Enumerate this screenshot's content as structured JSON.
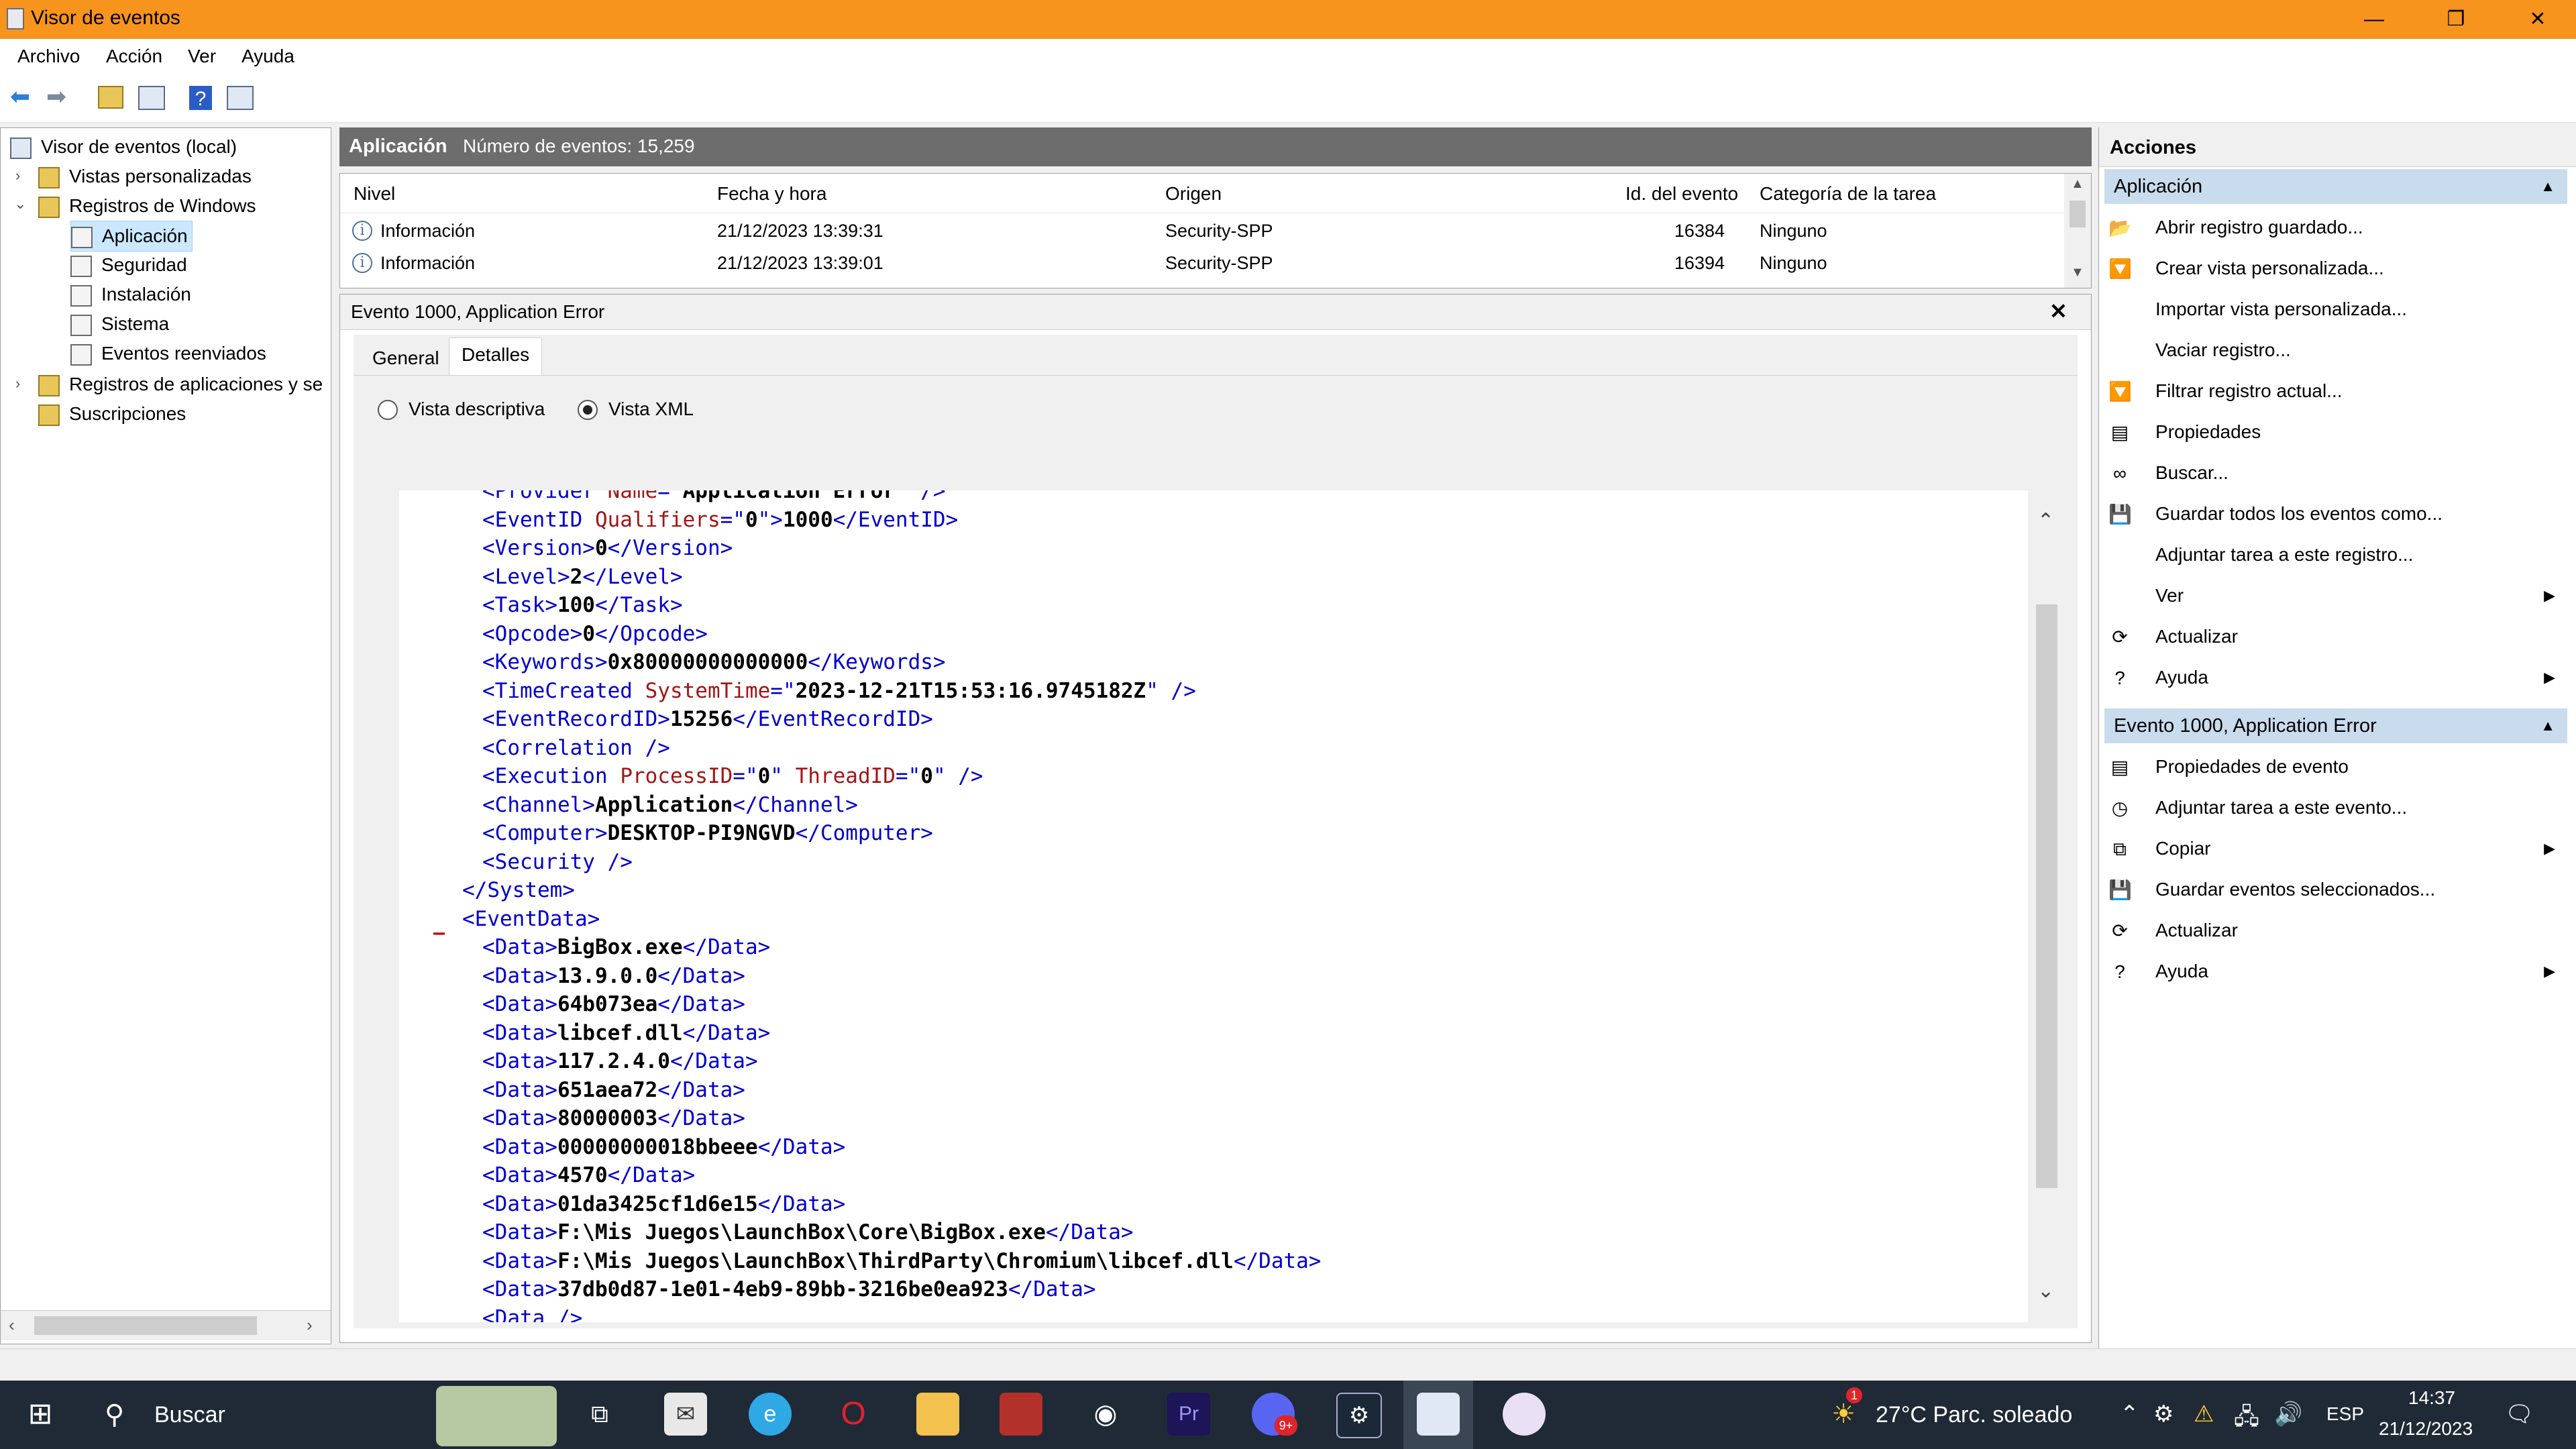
{
  "window": {
    "title": "Visor de eventos",
    "minimize_glyph": "—",
    "maximize_glyph": "❐",
    "close_glyph": "✕"
  },
  "menu": [
    "Archivo",
    "Acción",
    "Ver",
    "Ayuda"
  ],
  "toolbar_icons": [
    "back-arrow-icon",
    "forward-arrow-icon",
    "folder-up-icon",
    "show-hide-console-tree-icon",
    "help-icon",
    "show-hide-action-pane-icon"
  ],
  "tree": {
    "root": "Visor de eventos (local)",
    "custom_views": "Vistas personalizadas",
    "windows_logs": "Registros de Windows",
    "logs": [
      "Aplicación",
      "Seguridad",
      "Instalación",
      "Sistema",
      "Eventos reenviados"
    ],
    "app_logs": "Registros de aplicaciones y se",
    "subscriptions": "Suscripciones",
    "selected_log": "Aplicación"
  },
  "center": {
    "log_name": "Aplicación",
    "event_count": "Número de eventos: 15,259"
  },
  "events_table": {
    "columns": [
      "Nivel",
      "Fecha y hora",
      "Origen",
      "Id. del evento",
      "Categoría de la tarea"
    ],
    "rows": [
      {
        "level": "Información",
        "datetime": "21/12/2023 13:39:31",
        "source": "Security-SPP",
        "id": "16384",
        "category": "Ninguno"
      },
      {
        "level": "Información",
        "datetime": "21/12/2023 13:39:01",
        "source": "Security-SPP",
        "id": "16394",
        "category": "Ninguno"
      }
    ]
  },
  "detail": {
    "title": "Evento 1000, Application Error",
    "close_glyph": "✕",
    "tabs": [
      "General",
      "Detalles"
    ],
    "active_tab": "Detalles",
    "view_options": [
      "Vista descriptiva",
      "Vista XML"
    ],
    "selected_view": "Vista XML",
    "xml_collapse_marker": "–",
    "xml_lines": [
      [
        [
          "tag",
          "<Provider "
        ],
        [
          "attr",
          "Name"
        ],
        [
          "tag",
          "=\""
        ],
        [
          "val",
          "Application Error"
        ],
        [
          "tag",
          "\" />"
        ]
      ],
      [
        [
          "tag",
          "<EventID "
        ],
        [
          "attr",
          "Qualifiers"
        ],
        [
          "tag",
          "=\""
        ],
        [
          "val",
          "0"
        ],
        [
          "tag",
          "\">"
        ],
        [
          "val",
          "1000"
        ],
        [
          "tag",
          "</EventID>"
        ]
      ],
      [
        [
          "tag",
          "<Version>"
        ],
        [
          "val",
          "0"
        ],
        [
          "tag",
          "</Version>"
        ]
      ],
      [
        [
          "tag",
          "<Level>"
        ],
        [
          "val",
          "2"
        ],
        [
          "tag",
          "</Level>"
        ]
      ],
      [
        [
          "tag",
          "<Task>"
        ],
        [
          "val",
          "100"
        ],
        [
          "tag",
          "</Task>"
        ]
      ],
      [
        [
          "tag",
          "<Opcode>"
        ],
        [
          "val",
          "0"
        ],
        [
          "tag",
          "</Opcode>"
        ]
      ],
      [
        [
          "tag",
          "<Keywords>"
        ],
        [
          "val",
          "0x80000000000000"
        ],
        [
          "tag",
          "</Keywords>"
        ]
      ],
      [
        [
          "tag",
          "<TimeCreated "
        ],
        [
          "attr",
          "SystemTime"
        ],
        [
          "tag",
          "=\""
        ],
        [
          "val",
          "2023-12-21T15:53:16.9745182Z"
        ],
        [
          "tag",
          "\" />"
        ]
      ],
      [
        [
          "tag",
          "<EventRecordID>"
        ],
        [
          "val",
          "15256"
        ],
        [
          "tag",
          "</EventRecordID>"
        ]
      ],
      [
        [
          "tag",
          "<Correlation />"
        ]
      ],
      [
        [
          "tag",
          "<Execution "
        ],
        [
          "attr",
          "ProcessID"
        ],
        [
          "tag",
          "=\""
        ],
        [
          "val",
          "0"
        ],
        [
          "tag",
          "\" "
        ],
        [
          "attr",
          "ThreadID"
        ],
        [
          "tag",
          "=\""
        ],
        [
          "val",
          "0"
        ],
        [
          "tag",
          "\" />"
        ]
      ],
      [
        [
          "tag",
          "<Channel>"
        ],
        [
          "val",
          "Application"
        ],
        [
          "tag",
          "</Channel>"
        ]
      ],
      [
        [
          "tag",
          "<Computer>"
        ],
        [
          "val",
          "DESKTOP-PI9NGVD"
        ],
        [
          "tag",
          "</Computer>"
        ]
      ],
      [
        [
          "tag",
          "<Security />"
        ]
      ],
      [
        [
          "tag",
          "</System>"
        ]
      ],
      [
        [
          "tag",
          "<EventData>"
        ]
      ],
      [
        [
          "tag",
          "<Data>"
        ],
        [
          "val",
          "BigBox.exe"
        ],
        [
          "tag",
          "</Data>"
        ]
      ],
      [
        [
          "tag",
          "<Data>"
        ],
        [
          "val",
          "13.9.0.0"
        ],
        [
          "tag",
          "</Data>"
        ]
      ],
      [
        [
          "tag",
          "<Data>"
        ],
        [
          "val",
          "64b073ea"
        ],
        [
          "tag",
          "</Data>"
        ]
      ],
      [
        [
          "tag",
          "<Data>"
        ],
        [
          "val",
          "libcef.dll"
        ],
        [
          "tag",
          "</Data>"
        ]
      ],
      [
        [
          "tag",
          "<Data>"
        ],
        [
          "val",
          "117.2.4.0"
        ],
        [
          "tag",
          "</Data>"
        ]
      ],
      [
        [
          "tag",
          "<Data>"
        ],
        [
          "val",
          "651aea72"
        ],
        [
          "tag",
          "</Data>"
        ]
      ],
      [
        [
          "tag",
          "<Data>"
        ],
        [
          "val",
          "80000003"
        ],
        [
          "tag",
          "</Data>"
        ]
      ],
      [
        [
          "tag",
          "<Data>"
        ],
        [
          "val",
          "00000000018bbeee"
        ],
        [
          "tag",
          "</Data>"
        ]
      ],
      [
        [
          "tag",
          "<Data>"
        ],
        [
          "val",
          "4570"
        ],
        [
          "tag",
          "</Data>"
        ]
      ],
      [
        [
          "tag",
          "<Data>"
        ],
        [
          "val",
          "01da3425cf1d6e15"
        ],
        [
          "tag",
          "</Data>"
        ]
      ],
      [
        [
          "tag",
          "<Data>"
        ],
        [
          "val",
          "F:\\Mis Juegos\\LaunchBox\\Core\\BigBox.exe"
        ],
        [
          "tag",
          "</Data>"
        ]
      ],
      [
        [
          "tag",
          "<Data>"
        ],
        [
          "val",
          "F:\\Mis Juegos\\LaunchBox\\ThirdParty\\Chromium\\libcef.dll"
        ],
        [
          "tag",
          "</Data>"
        ]
      ],
      [
        [
          "tag",
          "<Data>"
        ],
        [
          "val",
          "37db0d87-1e01-4eb9-89bb-3216be0ea923"
        ],
        [
          "tag",
          "</Data>"
        ]
      ],
      [
        [
          "tag",
          "<Data />"
        ]
      ]
    ]
  },
  "actions": {
    "header": "Acciones",
    "section1": {
      "title": "Aplicación",
      "items": [
        {
          "label": "Abrir registro guardado...",
          "icon": "open-folder-icon",
          "glyph": "📂",
          "submenu": false
        },
        {
          "label": "Crear vista personalizada...",
          "icon": "filter-icon",
          "glyph": "🔽",
          "submenu": false
        },
        {
          "label": "Importar vista personalizada...",
          "icon": "",
          "glyph": "",
          "submenu": false
        },
        {
          "label": "Vaciar registro...",
          "icon": "",
          "glyph": "",
          "submenu": false
        },
        {
          "label": "Filtrar registro actual...",
          "icon": "filter-icon",
          "glyph": "🔽",
          "submenu": false
        },
        {
          "label": "Propiedades",
          "icon": "properties-icon",
          "glyph": "▤",
          "submenu": false
        },
        {
          "label": "Buscar...",
          "icon": "binoculars-icon",
          "glyph": "∞",
          "submenu": false
        },
        {
          "label": "Guardar todos los eventos como...",
          "icon": "save-icon",
          "glyph": "💾",
          "submenu": false
        },
        {
          "label": "Adjuntar tarea a este registro...",
          "icon": "",
          "glyph": "",
          "submenu": false
        },
        {
          "label": "Ver",
          "icon": "",
          "glyph": "",
          "submenu": true
        },
        {
          "label": "Actualizar",
          "icon": "refresh-icon",
          "glyph": "⟳",
          "submenu": false
        },
        {
          "label": "Ayuda",
          "icon": "help-icon",
          "glyph": "?",
          "submenu": true
        }
      ]
    },
    "section2": {
      "title": "Evento 1000, Application Error",
      "items": [
        {
          "label": "Propiedades de evento",
          "icon": "event-properties-icon",
          "glyph": "▤",
          "submenu": false
        },
        {
          "label": "Adjuntar tarea a este evento...",
          "icon": "task-clock-icon",
          "glyph": "◷",
          "submenu": false
        },
        {
          "label": "Copiar",
          "icon": "copy-icon",
          "glyph": "⧉",
          "submenu": true
        },
        {
          "label": "Guardar eventos seleccionados...",
          "icon": "save-icon",
          "glyph": "💾",
          "submenu": false
        },
        {
          "label": "Actualizar",
          "icon": "refresh-icon",
          "glyph": "⟳",
          "submenu": false
        },
        {
          "label": "Ayuda",
          "icon": "help-icon",
          "glyph": "?",
          "submenu": true
        }
      ]
    }
  },
  "taskbar": {
    "search_label": "Buscar",
    "weather": "27°C  Parc. soleado",
    "weather_badge": "1",
    "language": "ESP",
    "time": "14:37",
    "date": "21/12/2023",
    "discord_badge": "9+",
    "premiere_label": "Pr",
    "colors": {
      "background": "#1f2a36",
      "accent": "#f7941d"
    }
  }
}
